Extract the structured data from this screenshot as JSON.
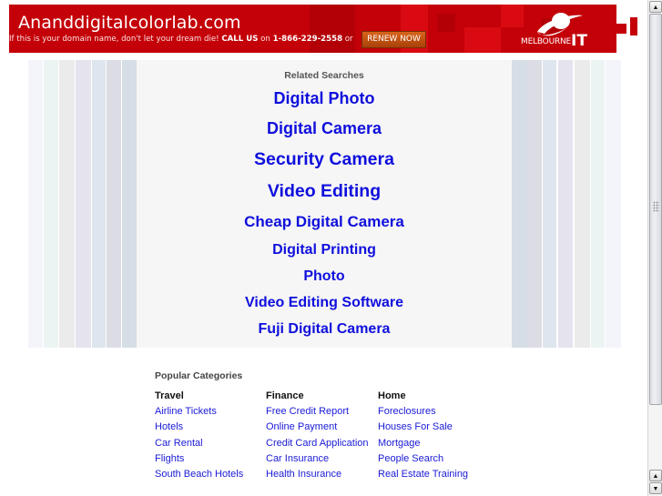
{
  "banner": {
    "domain_title": "Ananddigitalcolorlab.com",
    "message_prefix": "If this is your domain name, don't let your dream die! ",
    "call_us": "CALL US",
    "on_text": " on ",
    "phone": "1-866-229-2558",
    "or_text": " or",
    "renew_button": "RENEW NOW",
    "logo_text": "MELBOURNE",
    "logo_it": "IT",
    "logo_icon": "swoosh-globe-icon",
    "colors": {
      "background": "#c40008",
      "button": "#c2561a"
    }
  },
  "related": {
    "label": "Related Searches",
    "links": [
      "Digital Photo",
      "Digital Camera",
      "Security Camera",
      "Video Editing",
      "Cheap Digital Camera",
      "Digital Printing",
      "Photo",
      "Video Editing Software",
      "Fuji Digital Camera"
    ],
    "link_color": "#0f0fdd"
  },
  "popular": {
    "title": "Popular Categories",
    "columns": [
      {
        "heading": "Travel",
        "links": [
          "Airline Tickets",
          "Hotels",
          "Car Rental",
          "Flights",
          "South Beach Hotels"
        ]
      },
      {
        "heading": "Finance",
        "links": [
          "Free Credit Report",
          "Online Payment",
          "Credit Card Application",
          "Car Insurance",
          "Health Insurance"
        ]
      },
      {
        "heading": "Home",
        "links": [
          "Foreclosures",
          "Houses For Sale",
          "Mortgage",
          "People Search",
          "Real Estate Training"
        ]
      }
    ]
  },
  "scrollbar": {
    "up_icon": "arrow-up-icon",
    "down_icon": "arrow-down-icon",
    "up_glyph": "▲",
    "down_glyph": "▼"
  }
}
